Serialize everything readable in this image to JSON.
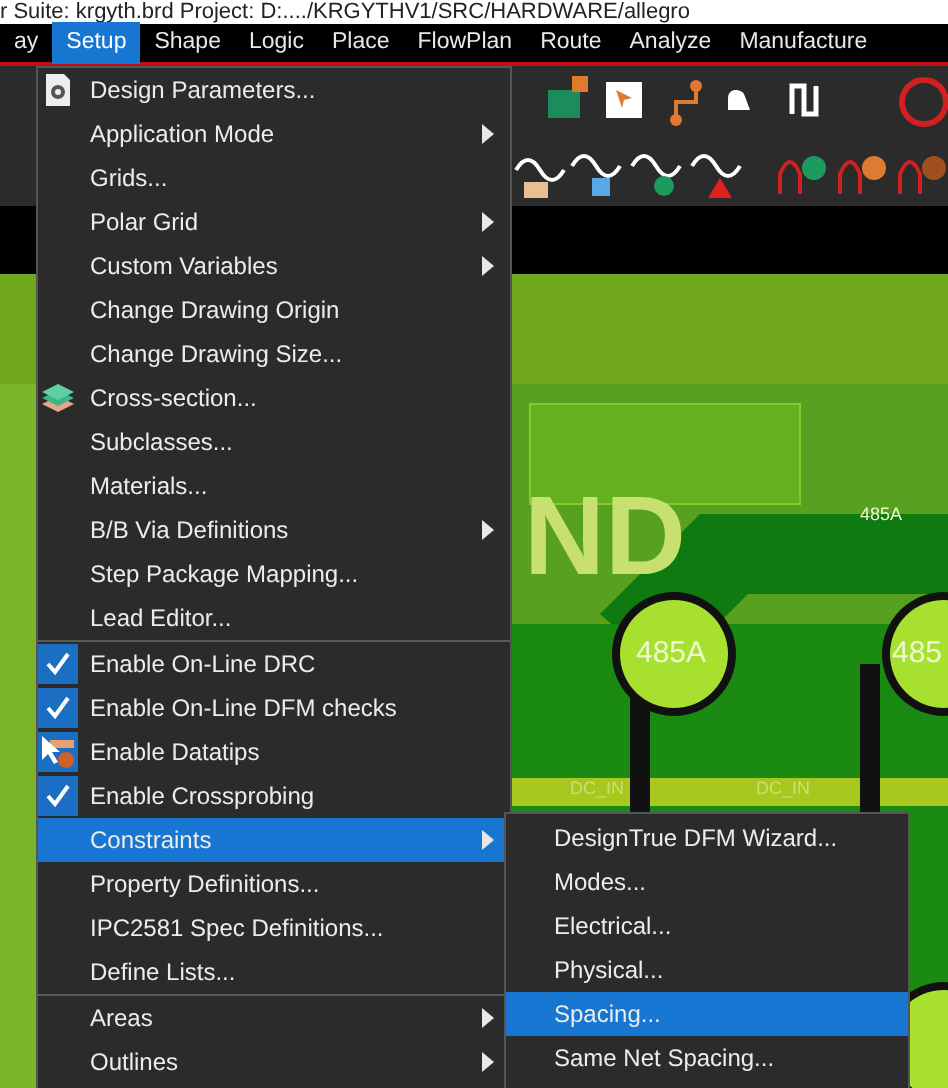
{
  "window": {
    "title": "r Suite: krgyth.brd  Project: D:..../KRGYTHV1/SRC/HARDWARE/allegro"
  },
  "menubar": [
    {
      "label": "ay",
      "selected": false
    },
    {
      "label": "Setup",
      "selected": true
    },
    {
      "label": "Shape",
      "selected": false
    },
    {
      "label": "Logic",
      "selected": false
    },
    {
      "label": "Place",
      "selected": false
    },
    {
      "label": "FlowPlan",
      "selected": false
    },
    {
      "label": "Route",
      "selected": false
    },
    {
      "label": "Analyze",
      "selected": false
    },
    {
      "label": "Manufacture",
      "selected": false
    }
  ],
  "menu": {
    "groups": [
      [
        {
          "label": "Design Parameters...",
          "kind": "gear",
          "submenu": false,
          "selected": false
        },
        {
          "label": "Application Mode",
          "kind": "plain",
          "submenu": true,
          "selected": false
        },
        {
          "label": "Grids...",
          "kind": "plain",
          "submenu": false,
          "selected": false
        },
        {
          "label": "Polar Grid",
          "kind": "plain",
          "submenu": true,
          "selected": false
        },
        {
          "label": "Custom Variables",
          "kind": "plain",
          "submenu": true,
          "selected": false
        },
        {
          "label": "Change Drawing Origin",
          "kind": "plain",
          "submenu": false,
          "selected": false
        },
        {
          "label": "Change Drawing Size...",
          "kind": "plain",
          "submenu": false,
          "selected": false
        },
        {
          "label": "Cross-section...",
          "kind": "layers",
          "submenu": false,
          "selected": false
        },
        {
          "label": "Subclasses...",
          "kind": "plain",
          "submenu": false,
          "selected": false
        },
        {
          "label": "Materials...",
          "kind": "plain",
          "submenu": false,
          "selected": false
        },
        {
          "label": "B/B Via Definitions",
          "kind": "plain",
          "submenu": true,
          "selected": false
        },
        {
          "label": "Step Package Mapping...",
          "kind": "plain",
          "submenu": false,
          "selected": false
        },
        {
          "label": "Lead Editor...",
          "kind": "plain",
          "submenu": false,
          "selected": false
        }
      ],
      [
        {
          "label": "Enable On-Line DRC",
          "kind": "check",
          "checked": true,
          "submenu": false,
          "selected": false
        },
        {
          "label": "Enable On-Line DFM checks",
          "kind": "check",
          "checked": true,
          "submenu": false,
          "selected": false
        },
        {
          "label": "Enable Datatips",
          "kind": "datatip",
          "submenu": false,
          "selected": false
        },
        {
          "label": "Enable Crossprobing",
          "kind": "check",
          "checked": true,
          "submenu": false,
          "selected": false
        },
        {
          "label": "Constraints",
          "kind": "plain",
          "submenu": true,
          "selected": true
        },
        {
          "label": "Property Definitions...",
          "kind": "plain",
          "submenu": false,
          "selected": false
        },
        {
          "label": "IPC2581 Spec Definitions...",
          "kind": "plain",
          "submenu": false,
          "selected": false
        },
        {
          "label": "Define Lists...",
          "kind": "plain",
          "submenu": false,
          "selected": false
        }
      ],
      [
        {
          "label": "Areas",
          "kind": "plain",
          "submenu": true,
          "selected": false
        },
        {
          "label": "Outlines",
          "kind": "plain",
          "submenu": true,
          "selected": false
        }
      ]
    ]
  },
  "submenu": [
    {
      "label": "DesignTrue DFM Wizard...",
      "selected": false
    },
    {
      "label": "Modes...",
      "selected": false
    },
    {
      "label": "Electrical...",
      "selected": false
    },
    {
      "label": "Physical...",
      "selected": false
    },
    {
      "label": "Spacing...",
      "selected": true
    },
    {
      "label": "Same Net Spacing...",
      "selected": false
    }
  ],
  "canvas": {
    "labels": [
      {
        "text": "ND",
        "kind": "big"
      },
      {
        "text": "485A",
        "kind": "pad"
      },
      {
        "text": "485",
        "kind": "pad"
      },
      {
        "text": "485A",
        "kind": "trace"
      },
      {
        "text": "DC_IN",
        "kind": "net"
      },
      {
        "text": "DC_IN",
        "kind": "net"
      }
    ]
  }
}
